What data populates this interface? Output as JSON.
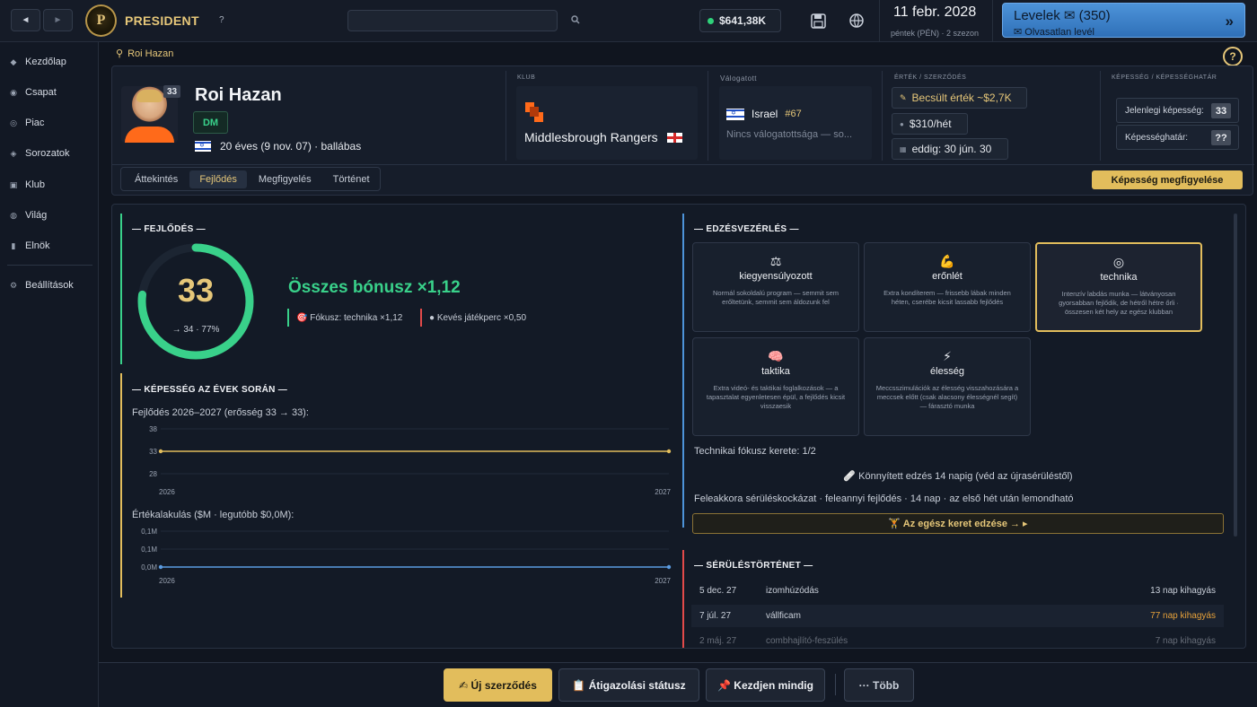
{
  "topbar": {
    "back": "◄",
    "fwd": "►",
    "brand": "PRESIDENT",
    "help": "?",
    "money": "$641,38K",
    "date": "11 febr. 2028",
    "date_sub": "péntek (PÉN) · 2 szezon",
    "mail_title": "Levelek ✉ (350)",
    "mail_sub": "✉ Olvasatlan levél",
    "mail_arrow": "»",
    "logo": "P"
  },
  "sidebar": {
    "items": [
      {
        "label": "Kezdőlap",
        "icon": "◆"
      },
      {
        "label": "Csapat",
        "icon": "◉"
      },
      {
        "label": "Piac",
        "icon": "◎"
      },
      {
        "label": "Sorozatok",
        "icon": "◈"
      },
      {
        "label": "Klub",
        "icon": "▣"
      },
      {
        "label": "Világ",
        "icon": "◍"
      },
      {
        "label": "Elnök",
        "icon": "▮"
      }
    ],
    "settings": {
      "label": "Beállítások",
      "icon": "⚙"
    }
  },
  "breadcrumb": "Roi Hazan",
  "header": {
    "ovr": "33",
    "name": "Roi Hazan",
    "position": "DM",
    "info": "20 éves (9 nov. 07) · ballábas",
    "club_label": "Klub",
    "club_name": "Middlesbrough Rangers",
    "nat_label": "Válogatott",
    "nat_name": "Israel",
    "nat_rank": "#67",
    "nat_none": "Nincs válogatottsága — so...",
    "value_label": "Érték / szerződés",
    "value_est": "Becsült érték ~$2,7K",
    "wage": "$310/hét",
    "until": "eddig: 30 jún. 30",
    "cap_label": "Képesség / képességhatár",
    "cap_current_label": "Jelenlegi képesség:",
    "cap_current": "33",
    "cap_pot_label": "Képességhatár:",
    "cap_pot": "??",
    "tabs": [
      "Áttekintés",
      "Fejlődés",
      "Megfigyelés",
      "Történet"
    ],
    "scout": "Képesség megfigyelése"
  },
  "dev": {
    "title": "— FEJLŐDÉS —",
    "ovr": "33",
    "sub": "→ 34 · 77%",
    "progress": 0.77,
    "bonus": "Összes bónusz ×1,12",
    "focus": "🎯 Fókusz: technika ×1,12",
    "few": "● Kevés játékperc ×0,50"
  },
  "history": {
    "title": "— KÉPESSÉG AZ ÉVEK SORÁN —",
    "label1": "Fejlődés 2026–2027 (erősség 33 → 33):",
    "label2": "Értékalakulás ($M · legutóbb $0,0M):"
  },
  "chart_data": [
    {
      "type": "line",
      "x": [
        "2026",
        "2027"
      ],
      "y": [
        33,
        33
      ],
      "yticks": [
        "38",
        "33",
        "28"
      ],
      "ylim": [
        28,
        38
      ],
      "color": "#e2bd5c"
    },
    {
      "type": "line",
      "x": [
        "2026",
        "2027"
      ],
      "y": [
        0.0,
        0.0
      ],
      "yticks": [
        "0,1M",
        "0,1M",
        "0,0M"
      ],
      "ylim": [
        0,
        0.1
      ],
      "color": "#5b9be0"
    }
  ],
  "training": {
    "title": "— EDZÉSVEZÉRLÉS —",
    "cards": [
      {
        "icon": "⚖",
        "title": "kiegyensúlyozott",
        "desc": "Normál sokoldalú program — semmit sem erőltetünk, semmit sem áldozunk fel"
      },
      {
        "icon": "💪",
        "title": "erőnlét",
        "desc": "Extra kondíterem — frissebb lábak minden héten, cserébe kicsit lassabb fejlődés"
      },
      {
        "icon": "◎",
        "title": "technika",
        "desc": "Intenzív labdás munka — látványosan gyorsabban fejlődik, de hétről hétre őrli · összesen két hely az egész klubban"
      },
      {
        "icon": "🧠",
        "title": "taktika",
        "desc": "Extra videó- és taktikai foglalkozások — a tapasztalat egyenletesen épül, a fejlődés kicsit visszaesik"
      },
      {
        "icon": "⚡",
        "title": "élesség",
        "desc": "Meccsszimulációk az élesség visszahozására a meccsek előtt (csak alacsony élességnél segít) — fárasztó munka"
      }
    ],
    "focus_quota": "Technikai fókusz kerete: 1/2",
    "eased": "🩹 Könnyített edzés 14 napig (véd az újrasérüléstől)",
    "risk": "Feleakkora sérüléskockázat · feleannyi fejlődés · 14 nap · az első hét után lemondható",
    "whole": "🏋 Az egész keret edzése → ▸"
  },
  "injuries": {
    "title": "— SÉRÜLÉSTÖRTÉNET —",
    "rows": [
      {
        "date": "5 dec. 27",
        "type": "izomhúzódás",
        "miss": "13 nap kihagyás"
      },
      {
        "date": "7 júl. 27",
        "type": "vállficam",
        "miss": "77 nap kihagyás"
      },
      {
        "date": "2 máj. 27",
        "type": "combhajlító-feszülés",
        "miss": "7 nap kihagyás"
      }
    ]
  },
  "bottom": {
    "contract": "✍ Új szerződés",
    "transfer": "📋 Átigazolási státusz",
    "start": "📌 Kezdjen mindig",
    "more": "··· Több"
  }
}
